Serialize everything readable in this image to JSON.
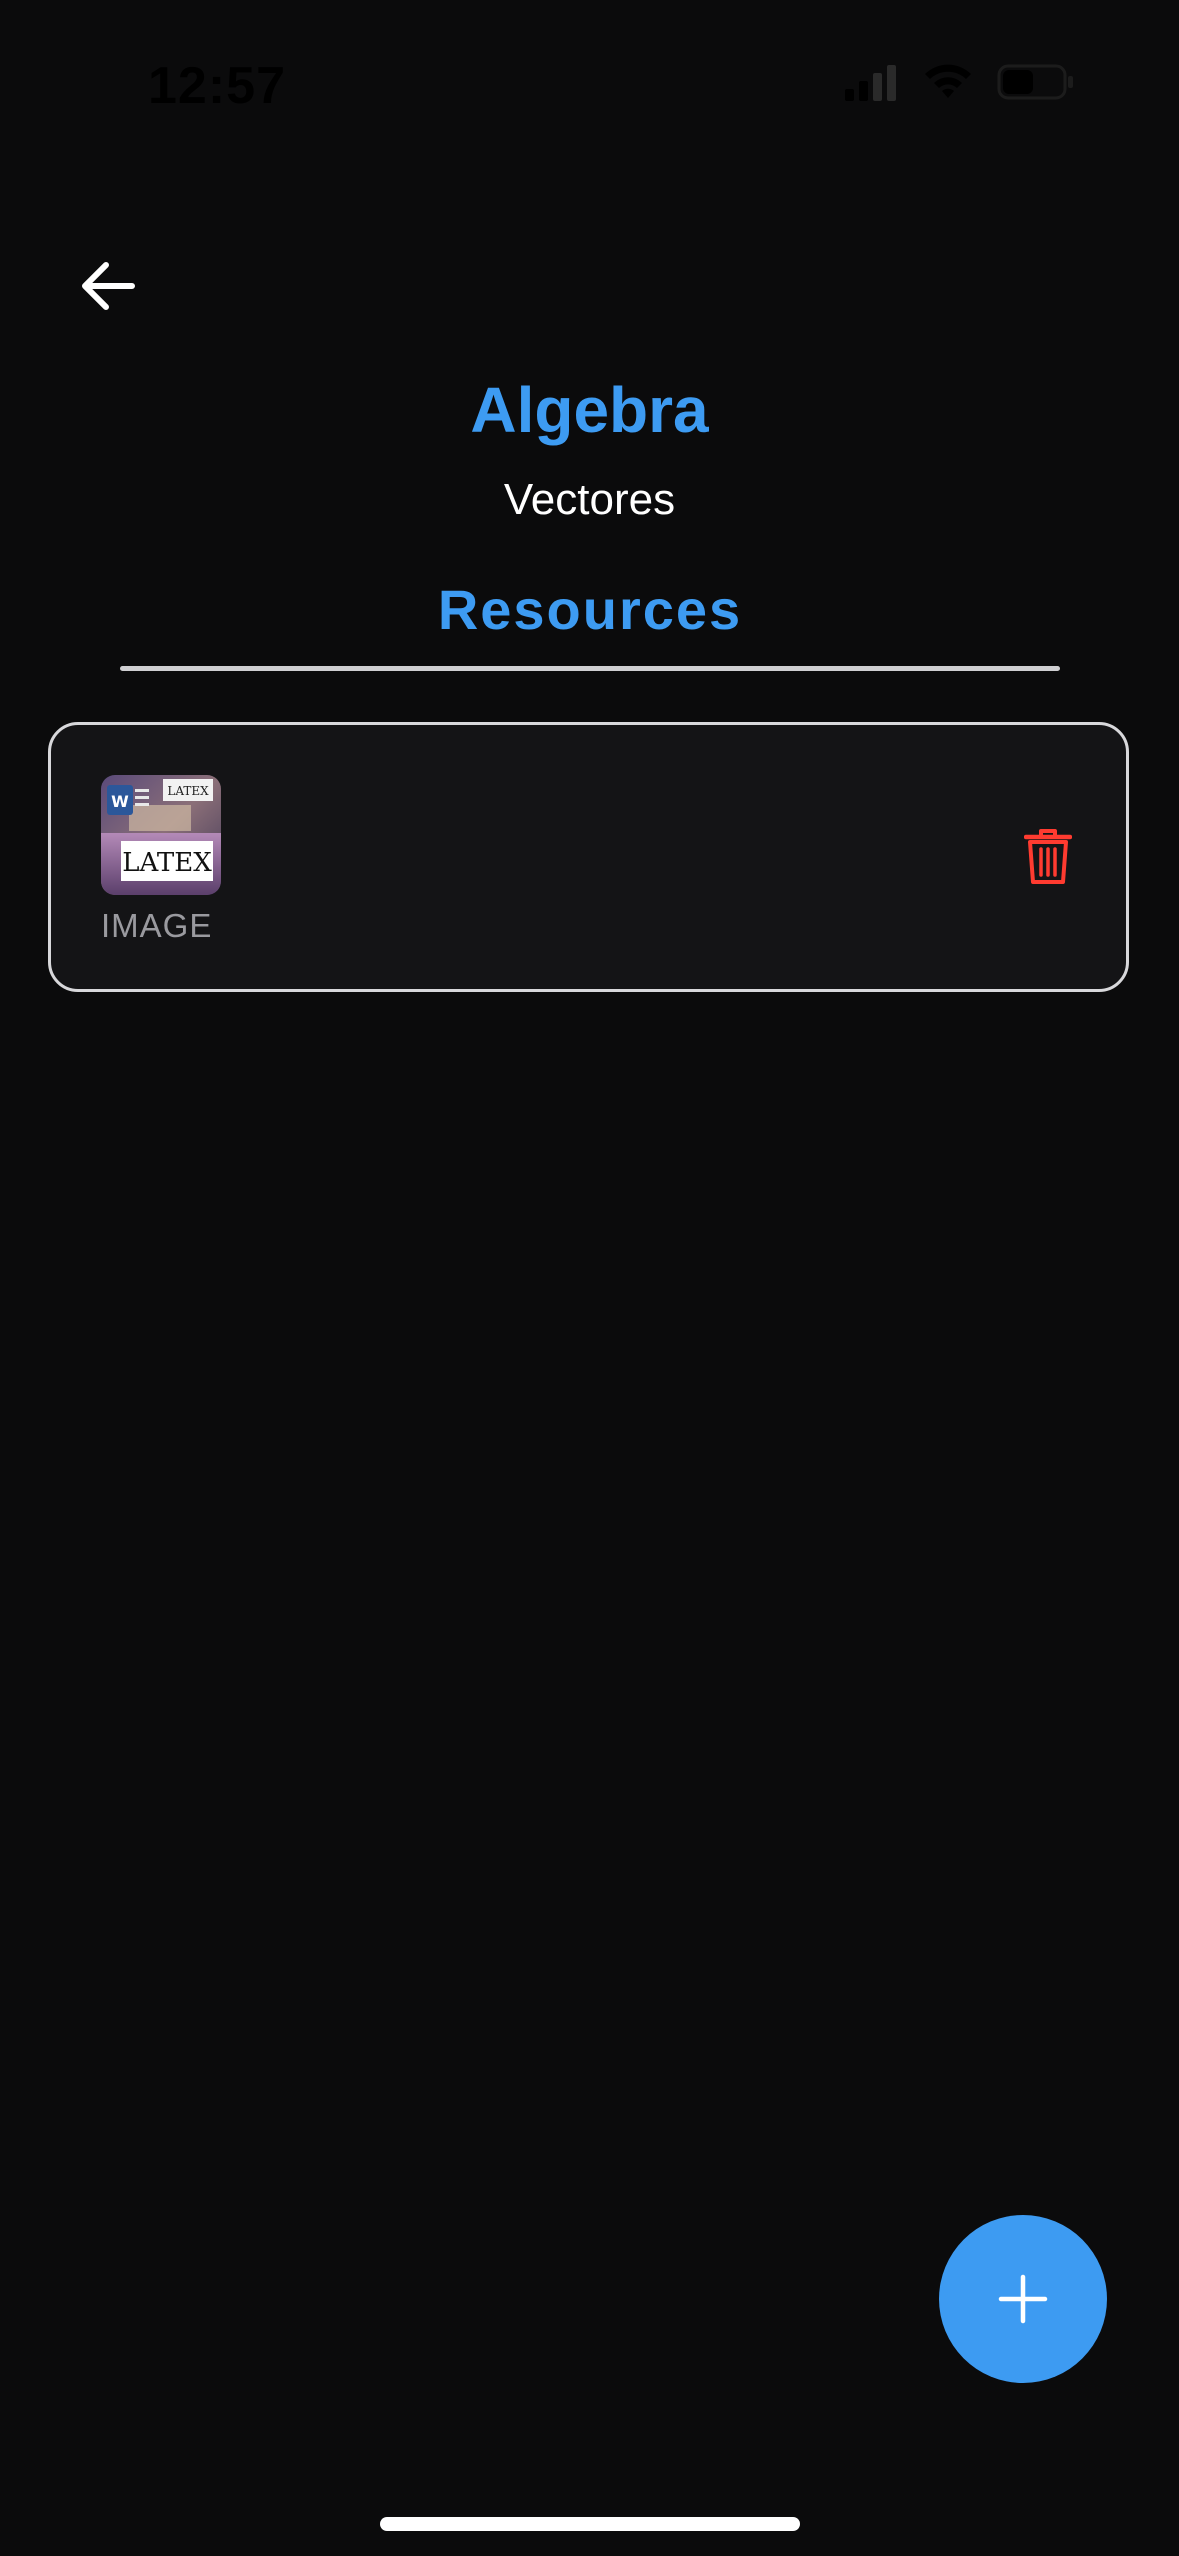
{
  "status_bar": {
    "time": "12:57",
    "icons": [
      "cellular-signal-icon",
      "wifi-icon",
      "battery-icon"
    ]
  },
  "header": {
    "back_icon": "arrow-left-icon",
    "title": "Algebra",
    "subtitle": "Vectores"
  },
  "tabs": [
    {
      "label": "Resources",
      "active": true
    }
  ],
  "resources": [
    {
      "thumbnail_icon": "latex-word-image-thumbnail",
      "thumbnail_text": "LATEX",
      "type": "IMAGE",
      "action_icon": "trash-icon"
    }
  ],
  "fab": {
    "icon": "plus-icon"
  },
  "colors": {
    "background": "#0b0b0c",
    "accent": "#3d9bf2",
    "danger": "#ff3b30",
    "card_border": "#d8d8db",
    "muted_text": "#9a9a9f"
  }
}
